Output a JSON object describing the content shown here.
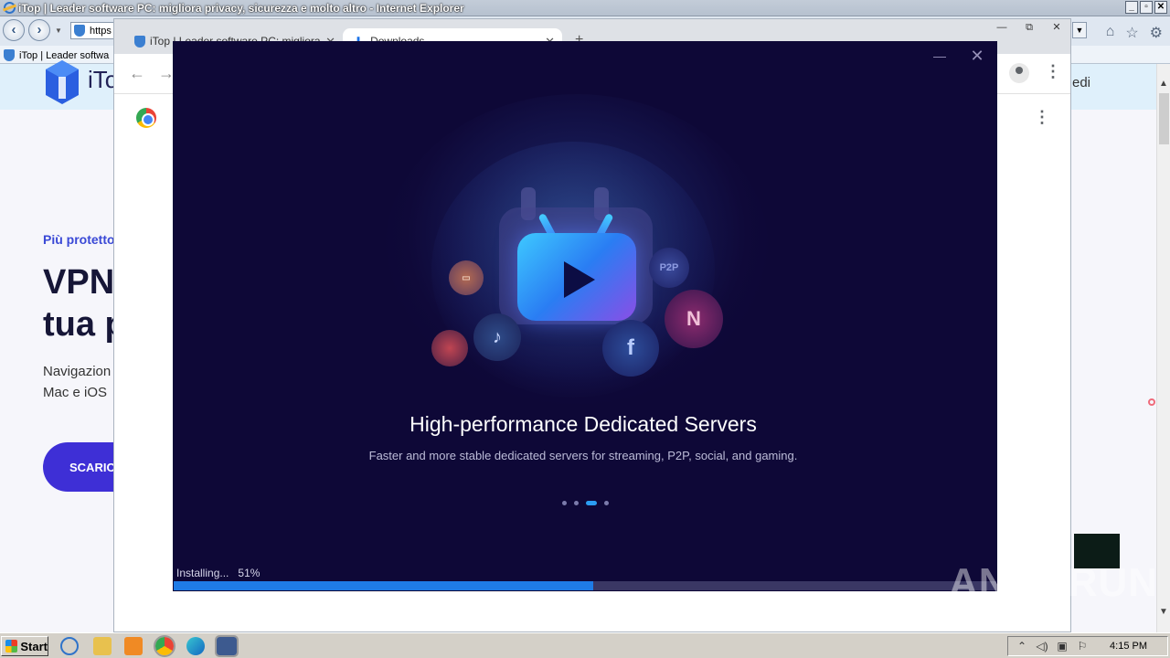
{
  "ie": {
    "window_title": "iTop | Leader software PC: migliora privacy, sicurezza e molto altro - Internet Explorer",
    "address_text": "https",
    "tab_label": "iTop | Leader softwa",
    "title_controls": [
      "_",
      "▫",
      "✕"
    ],
    "right_icons": [
      "home-icon",
      "star-icon",
      "gear-icon"
    ]
  },
  "page": {
    "brand": "iTop",
    "nav_right_fragment": "edi",
    "subtitle": "Più protetto",
    "heading_line1": "VPN",
    "heading_line2": "tua p",
    "body_line1": "Navigazion",
    "body_line2": "Mac e iOS",
    "cta_label": "SCARICA"
  },
  "chrome": {
    "tab1_label": "iTop | Leader software PC: migliora",
    "tab2_label": "Downloads",
    "new_tab_symbol": "+",
    "tab_close": "✕",
    "window_controls": [
      "—",
      "⧉",
      "✕"
    ]
  },
  "installer": {
    "title": "High-performance Dedicated Servers",
    "subtitle": "Faster and more stable dedicated servers for streaming, P2P, social, and gaming.",
    "status_text": "Installing...",
    "progress_text": "51%",
    "progress_value": 0.51,
    "carousel_count": 4,
    "carousel_active_index": 2,
    "minimize_symbol": "—",
    "close_symbol": "✕",
    "bubbles": {
      "p2p": "P2P",
      "netflix": "N",
      "facebook": "f",
      "tiktok": "♪"
    },
    "accent_color": "#1f7be6",
    "background_color": "#0e0837"
  },
  "watermark": "ANY▷RUN",
  "taskbar": {
    "start_label": "Start",
    "clock": "4:15 PM",
    "apps": [
      "ie-icon",
      "folder-icon",
      "media-icon",
      "chrome-icon",
      "edge-icon",
      "installer-icon"
    ]
  }
}
